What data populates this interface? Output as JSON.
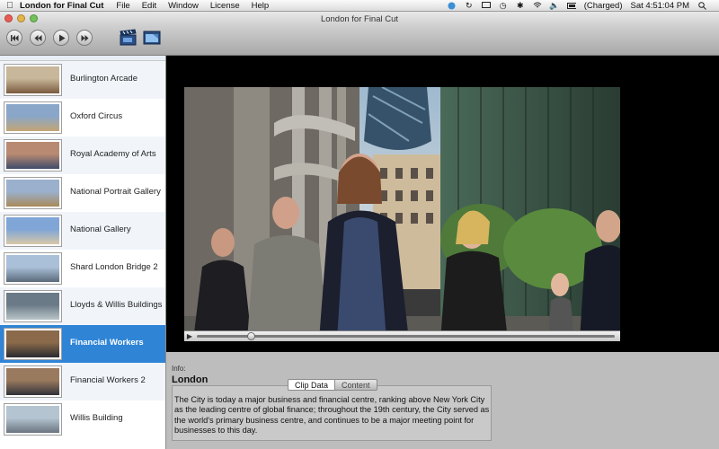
{
  "menubar": {
    "app_name": "London for Final Cut",
    "menus": [
      "File",
      "Edit",
      "Window",
      "License",
      "Help"
    ],
    "battery": "(Charged)",
    "clock": "Sat 4:51:04 PM"
  },
  "window": {
    "title": "London for Final Cut"
  },
  "colors": {
    "selection": "#2f84d6",
    "close": "#ec5b53",
    "minimize": "#e5b34a",
    "zoom": "#73c15a"
  },
  "sidebar": {
    "items": [
      {
        "label": "Burlington Arcade",
        "selected": false
      },
      {
        "label": "Oxford Circus",
        "selected": false
      },
      {
        "label": "Royal Academy of Arts",
        "selected": false
      },
      {
        "label": "National Portrait Gallery",
        "selected": false
      },
      {
        "label": "National Gallery",
        "selected": false
      },
      {
        "label": "Shard London Bridge 2",
        "selected": false
      },
      {
        "label": "Lloyds & Willis Buildings",
        "selected": false
      },
      {
        "label": "Financial Workers",
        "selected": true
      },
      {
        "label": "Financial Workers 2",
        "selected": false
      },
      {
        "label": "Willis Building",
        "selected": false
      }
    ]
  },
  "info": {
    "label": "Info:",
    "place": "London",
    "tabs": [
      "Clip Data",
      "Content"
    ],
    "active_tab": "Clip Data",
    "description": "The City is today a major business and financial centre, ranking above New York City as the leading centre of global finance; throughout the 19th century, the City served as the world's primary business centre, and continues to be a major meeting point for businesses to this day."
  },
  "player": {
    "progress": 0.13
  }
}
